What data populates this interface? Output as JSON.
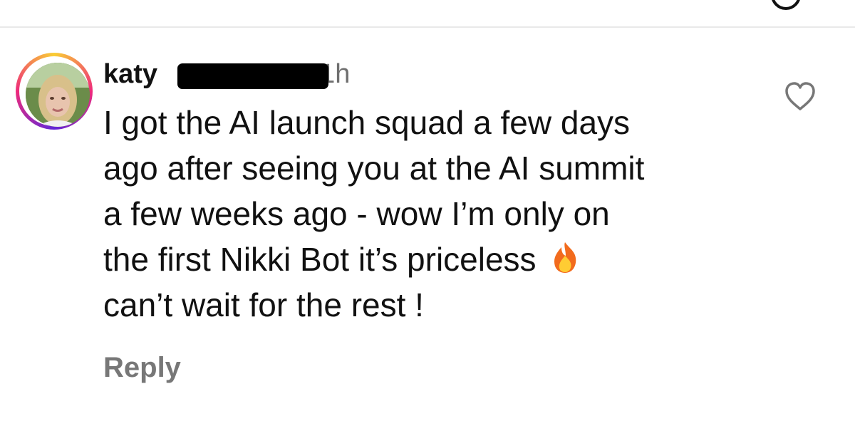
{
  "comment": {
    "username": "katy",
    "time": "1h",
    "lines": [
      "I got the AI launch squad a few days",
      "ago after seeing you at the AI summit",
      "a few weeks ago - wow I’m only on",
      "the first Nikki Bot it’s priceless",
      "can’t wait for the rest !"
    ],
    "emoji": "fire-emoji",
    "reply_label": "Reply"
  },
  "icons": {
    "like": "heart-outline-icon",
    "top": "circle-icon"
  },
  "colors": {
    "text": "#111111",
    "muted": "#777777",
    "divider": "#e9e9e9",
    "story_ring": [
      "#f9ce34",
      "#ee2a7b",
      "#6228d7"
    ]
  }
}
